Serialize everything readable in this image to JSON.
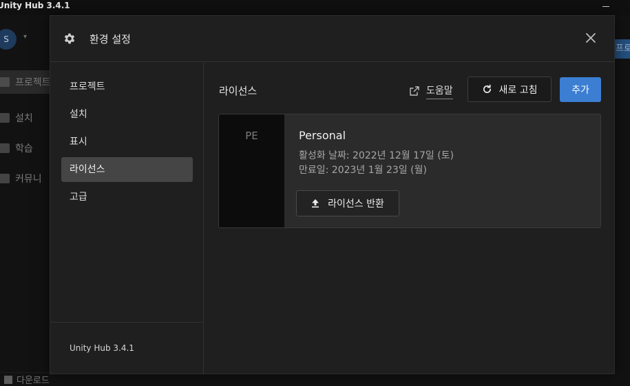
{
  "window": {
    "title": "Unity Hub 3.4.1"
  },
  "background": {
    "avatar_initial": "S",
    "sidebar": [
      {
        "label": "프로젝트"
      },
      {
        "label": "설치"
      },
      {
        "label": "학습"
      },
      {
        "label": "커뮤니"
      }
    ],
    "right_button_label": "프로",
    "bottom_label": "다운로드"
  },
  "modal": {
    "title": "환경 설정",
    "icons": {
      "gear": "gear-icon",
      "close": "close-icon",
      "external": "external-link-icon",
      "refresh": "refresh-icon",
      "upload": "upload-icon"
    },
    "nav": [
      {
        "label": "프로젝트"
      },
      {
        "label": "설치"
      },
      {
        "label": "표시"
      },
      {
        "label": "라이선스"
      },
      {
        "label": "고급"
      }
    ],
    "active_nav": "라이선스",
    "version": "Unity Hub 3.4.1",
    "license_section": {
      "title": "라이선스",
      "help_label": "도움말",
      "refresh_label": "새로 고침",
      "add_label": "추가",
      "card": {
        "badge": "PE",
        "name": "Personal",
        "activated": "활성화 날짜: 2022년 12월 17일 (토)",
        "expires": "만료일: 2023년 1월 23일 (월)",
        "return_label": "라이선스 반환"
      }
    }
  },
  "colors": {
    "accent": "#3b7ed2",
    "active_nav_bg": "#454545",
    "modal_bg": "#1f1f1f",
    "card_bg": "#2b2b2b"
  }
}
